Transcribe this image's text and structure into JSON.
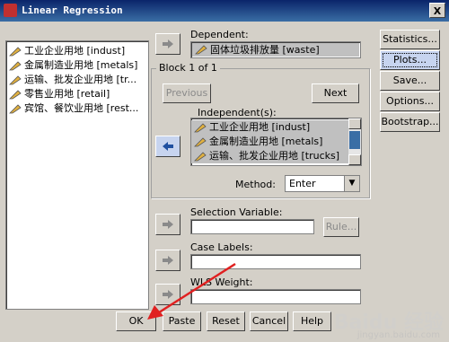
{
  "window": {
    "title": "Linear Regression",
    "close_label": "X"
  },
  "source_variables": [
    "工业企业用地 [indust]",
    "金属制造业用地 [metals]",
    "运输、批发企业用地 [tr...",
    "零售业用地 [retail]",
    "宾馆、餐饮业用地 [rest..."
  ],
  "dependent": {
    "label": "Dependent:",
    "value": "固体垃圾排放量 [waste]"
  },
  "block": {
    "caption": "Block 1 of 1",
    "previous_label": "Previous",
    "next_label": "Next",
    "independents_label": "Independent(s):",
    "independents": [
      "工业企业用地 [indust]",
      "金属制造业用地 [metals]",
      "运输、批发企业用地 [trucks]"
    ],
    "method_label": "Method:",
    "method_value": "Enter"
  },
  "selection_variable": {
    "label": "Selection Variable:",
    "rule_label": "Rule..."
  },
  "case_labels": {
    "label": "Case Labels:"
  },
  "wls_weight": {
    "label": "WLS Weight:"
  },
  "side_buttons": [
    "Statistics...",
    "Plots...",
    "Save...",
    "Options...",
    "Bootstrap..."
  ],
  "bottom_buttons": [
    "OK",
    "Paste",
    "Reset",
    "Cancel",
    "Help"
  ],
  "watermark": {
    "text": "Baidu 经验",
    "sub": "jingyan.baidu.com"
  },
  "colors": {
    "titlebar": "#0a246a",
    "dialog_bg": "#d4d0c8",
    "annotation_arrow": "#e02020"
  }
}
